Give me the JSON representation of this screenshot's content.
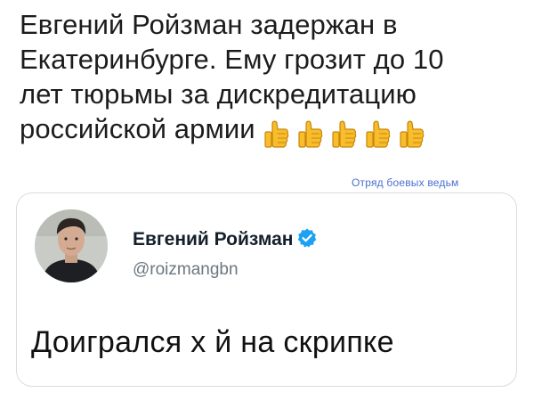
{
  "headline": {
    "line1": "Евгений Ройзман задержан в",
    "line2": "Екатеринбурге. Ему грозит до 10",
    "line3": "лет тюрьмы за дискредитацию",
    "line4": "российской армии"
  },
  "emoji": {
    "icon": "thumbs-up-icon",
    "count": 5,
    "color": "#f4b41a"
  },
  "watermark": "Отряд боевых ведьм",
  "tweet": {
    "author_name": "Евгений Ройзман",
    "handle": "@roizmangbn",
    "text": "Доигрался х  й на скрипке",
    "verified_color": "#1da1f2",
    "verified_icon": "verified-badge-icon",
    "avatar_icon": "avatar-photo"
  }
}
